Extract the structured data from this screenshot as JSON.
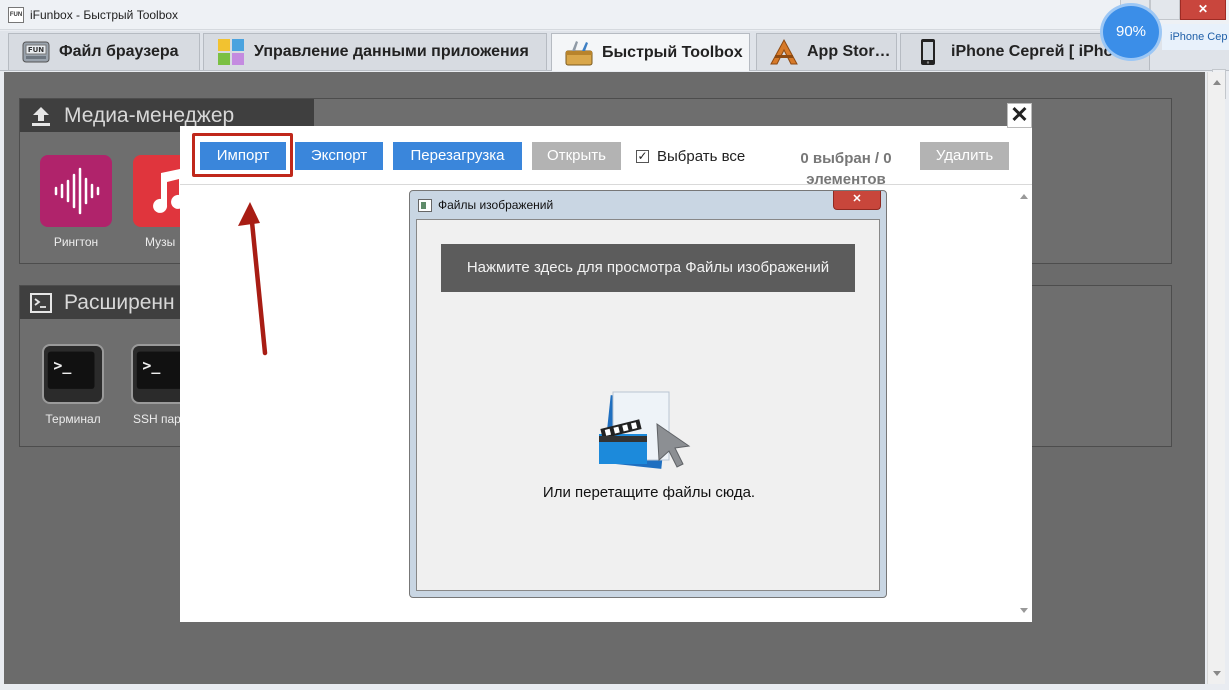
{
  "window": {
    "title": "iFunbox - Быстрый Toolbox",
    "app_icon_text": "FUN",
    "zoom_badge": "90%",
    "device_pill": "iPhone Сер",
    "close_symbol": "✕"
  },
  "tabs": [
    {
      "label": "Файл браузера",
      "icon": "fun-drive-icon",
      "active": false
    },
    {
      "label": "Управление данными приложения",
      "icon": "app-grid-icon",
      "active": false
    },
    {
      "label": "Быстрый Toolbox",
      "icon": "toolbox-icon",
      "active": true
    },
    {
      "label": "App Stor…",
      "icon": "app-store-icon",
      "active": false
    },
    {
      "label": "iPhone Сергей [ iPhon…",
      "icon": "iphone-icon",
      "active": false
    }
  ],
  "sections": {
    "media": {
      "title": "Медиа-менеджер",
      "tiles": [
        {
          "label": "Рингтон",
          "color": "#b0236b"
        },
        {
          "label": "Музы",
          "color": "#e0353d"
        }
      ]
    },
    "advanced": {
      "title": "Расширенн",
      "tiles": [
        {
          "label": "Терминал"
        },
        {
          "label": "SSH пар"
        }
      ]
    }
  },
  "dialog": {
    "close_symbol": "✕",
    "buttons": {
      "import": "Импорт",
      "export": "Экспорт",
      "reload": "Перезагрузка",
      "open": "Открыть",
      "delete": "Удалить"
    },
    "select_all": {
      "label": "Выбрать все",
      "checked": true,
      "mark": "✓"
    },
    "count_line1": "0 выбран / 0",
    "count_line2": "элементов",
    "colors": {
      "primary": "#3a86db",
      "disabled": "#b3b3b3",
      "highlight": "#c0281b"
    }
  },
  "file_window": {
    "title": "Файлы изображений",
    "close_symbol": "✕",
    "browse_button": "Нажмите здесь для просмотра Файлы изображений",
    "drop_hint": "Или перетащите файлы сюда."
  }
}
